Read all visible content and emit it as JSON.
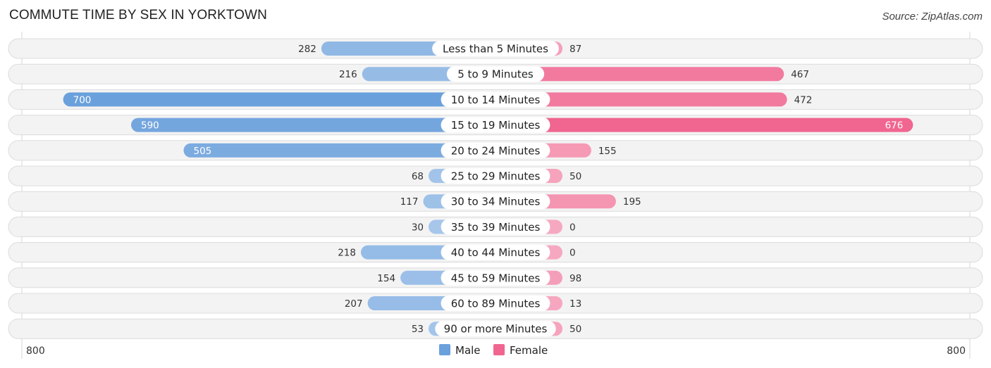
{
  "title": "COMMUTE TIME BY SEX IN YORKTOWN",
  "source": "Source: ZipAtlas.com",
  "colors": {
    "male": "#6aa0dc",
    "male_light": "#a9c8eb",
    "female": "#f06690",
    "female_light": "#f6a8c0"
  },
  "chart_data": {
    "type": "bar",
    "orientation": "horizontal-diverging",
    "title": "COMMUTE TIME BY SEX IN YORKTOWN",
    "categories": [
      "Less than 5 Minutes",
      "5 to 9 Minutes",
      "10 to 14 Minutes",
      "15 to 19 Minutes",
      "20 to 24 Minutes",
      "25 to 29 Minutes",
      "30 to 34 Minutes",
      "35 to 39 Minutes",
      "40 to 44 Minutes",
      "45 to 59 Minutes",
      "60 to 89 Minutes",
      "90 or more Minutes"
    ],
    "series": [
      {
        "name": "Male",
        "values": [
          282,
          216,
          700,
          590,
          505,
          68,
          117,
          30,
          218,
          154,
          207,
          53
        ]
      },
      {
        "name": "Female",
        "values": [
          87,
          467,
          472,
          676,
          155,
          50,
          195,
          0,
          0,
          98,
          13,
          50
        ]
      }
    ],
    "xlim": [
      -800,
      800
    ],
    "axis_labels": {
      "left": "800",
      "right": "800"
    },
    "legend": {
      "position": "bottom-center",
      "entries": [
        "Male",
        "Female"
      ]
    },
    "grid": false
  }
}
